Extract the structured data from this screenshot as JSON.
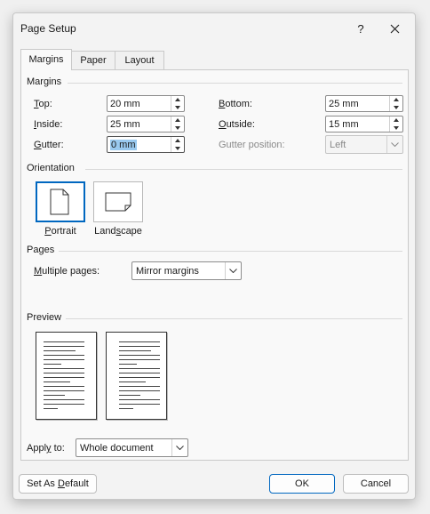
{
  "dialog": {
    "title": "Page Setup",
    "help": "?"
  },
  "tabs": [
    {
      "label": "Margins"
    },
    {
      "label": "Paper"
    },
    {
      "label": "Layout"
    }
  ],
  "margins": {
    "section": "Margins",
    "top": {
      "label_u": "T",
      "label_rest": "op:",
      "value": "20 mm"
    },
    "inside": {
      "label_u": "I",
      "label_rest": "nside:",
      "value": "25 mm"
    },
    "gutter": {
      "label_u": "G",
      "label_rest": "utter:",
      "value": "0 mm"
    },
    "bottom": {
      "label_u": "B",
      "label_rest": "ottom:",
      "value": "25 mm"
    },
    "outside": {
      "label_u": "O",
      "label_rest": "utside:",
      "value": "15 mm"
    },
    "gutter_position": {
      "label": "Gutter position:",
      "value": "Left"
    }
  },
  "orientation": {
    "section": "Orientation",
    "portrait": {
      "label_u": "P",
      "label_rest": "ortrait"
    },
    "landscape": {
      "label_pre": "Land",
      "label_u": "s",
      "label_rest": "cape"
    }
  },
  "pages": {
    "section": "Pages",
    "multiple_label_u": "M",
    "multiple_label_rest": "ultiple pages:",
    "multiple_value": "Mirror margins"
  },
  "preview": {
    "section": "Preview"
  },
  "apply": {
    "label_pre": "Appl",
    "label_u": "y",
    "label_rest": " to:",
    "value": "Whole document"
  },
  "buttons": {
    "default_pre": "Set As ",
    "default_u": "D",
    "default_rest": "efault",
    "ok": "OK",
    "cancel": "Cancel"
  }
}
